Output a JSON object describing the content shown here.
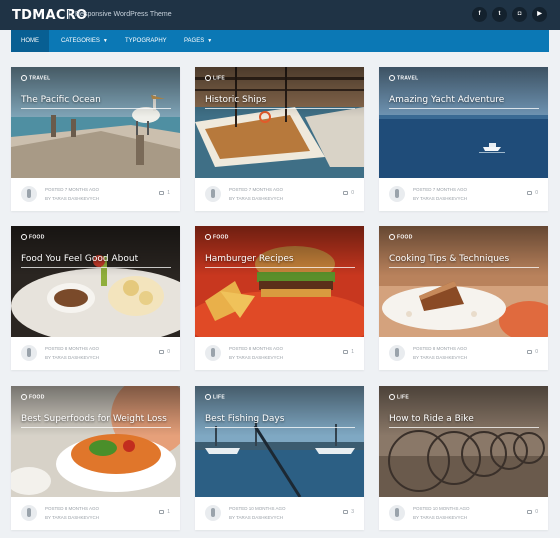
{
  "site": {
    "logo": "TDMACRO",
    "tagline": "Responsive WordPress Theme"
  },
  "social": [
    {
      "icon": "facebook-icon",
      "glyph": "f"
    },
    {
      "icon": "twitter-icon",
      "glyph": "t"
    },
    {
      "icon": "instagram-icon",
      "glyph": "◘"
    },
    {
      "icon": "youtube-icon",
      "glyph": "▶"
    }
  ],
  "nav": [
    {
      "label": "HOME",
      "active": true,
      "dropdown": false
    },
    {
      "label": "CATEGORIES",
      "active": false,
      "dropdown": true
    },
    {
      "label": "TYPOGRAPHY",
      "active": false,
      "dropdown": false
    },
    {
      "label": "PAGES",
      "active": false,
      "dropdown": true
    }
  ],
  "posts": [
    {
      "category": "TRAVEL",
      "title": "The Pacific Ocean",
      "posted": "POSTED 7 MONTHS AGO",
      "author": "BY TARAS DASHKEVYCH",
      "comments": "1",
      "image": "pier-pelican"
    },
    {
      "category": "LIFE",
      "title": "Historic Ships",
      "posted": "POSTED 7 MONTHS AGO",
      "author": "BY TARAS DASHKEVYCH",
      "comments": "0",
      "image": "ships"
    },
    {
      "category": "TRAVEL",
      "title": "Amazing Yacht Adventure",
      "posted": "POSTED 7 MONTHS AGO",
      "author": "BY TARAS DASHKEVYCH",
      "comments": "0",
      "image": "yacht"
    },
    {
      "category": "FOOD",
      "title": "Food You Feel Good About",
      "posted": "POSTED 8 MONTHS AGO",
      "author": "BY TARAS DASHKEVYCH",
      "comments": "0",
      "image": "snack-plate"
    },
    {
      "category": "FOOD",
      "title": "Hamburger Recipes",
      "posted": "POSTED 8 MONTHS AGO",
      "author": "BY TARAS DASHKEVYCH",
      "comments": "1",
      "image": "hamburger"
    },
    {
      "category": "FOOD",
      "title": "Cooking Tips & Techniques",
      "posted": "POSTED 8 MONTHS AGO",
      "author": "BY TARAS DASHKEVYCH",
      "comments": "0",
      "image": "cake"
    },
    {
      "category": "FOOD",
      "title": "Best Superfoods for Weight Loss",
      "posted": "POSTED 8 MONTHS AGO",
      "author": "BY TARAS DASHKEVYCH",
      "comments": "1",
      "image": "salad-bowl"
    },
    {
      "category": "LIFE",
      "title": "Best Fishing Days",
      "posted": "POSTED 10 MONTHS AGO",
      "author": "BY TARAS DASHKEVYCH",
      "comments": "3",
      "image": "fishing-harbor"
    },
    {
      "category": "LIFE",
      "title": "How to Ride a Bike",
      "posted": "POSTED 10 MONTHS AGO",
      "author": "BY TARAS DASHKEVYCH",
      "comments": "0",
      "image": "bicycles"
    }
  ],
  "colors": {
    "topbar": "#1f3345",
    "nav": "#0b78b5",
    "nav_active": "#085f93",
    "background": "#eef1f4"
  }
}
